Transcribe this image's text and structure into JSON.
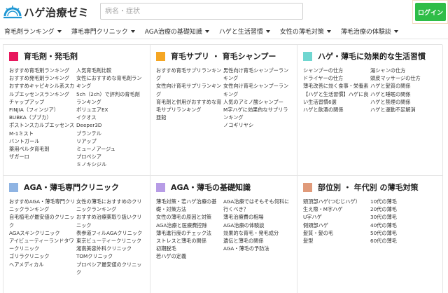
{
  "header": {
    "logo_text": "ハゲ治療ゼミ",
    "search_placeholder": "病名・症状",
    "login_label": "ログイン"
  },
  "nav": [
    "育毛剤ランキング",
    "薄毛専門クリニック",
    "AGA治療の基礎知識",
    "ハゲと生活習慣",
    "女性の薄毛対策",
    "薄毛治療の体験談"
  ],
  "colors": {
    "accent_green": "#2fbd47",
    "logo_blue": "#1f97d4"
  },
  "categories": [
    {
      "title": "育毛剤・発毛剤",
      "color": "#e8175d",
      "col1": [
        "おすすめ育毛剤ランキング",
        "おすすめ発毛剤ランキング",
        "おすすめキャピキシル系スカルプエッセンスランキング",
        "チャップアップ",
        "FINJIA（フィンジア）",
        "BUBKA（ブブカ）",
        "ポストンスカルプエッセンス",
        "M-1ミスト",
        "バントガール",
        "薬用ペルタ育毛剤",
        "ザガーロ"
      ],
      "col2": [
        "人気育毛剤比較",
        "女性におすすめな育毛剤ランキング",
        "5ch（2ch）で評判の育毛剤ランキング",
        "ボリュエアEX",
        "イクオス",
        "Deeper3D",
        "プランテル",
        "リアップ",
        "ミューノアージュ",
        "プロペシア",
        "ミノキシジル"
      ]
    },
    {
      "title": "育毛サプリ ・ 育毛シャンプー",
      "color": "#f5a623",
      "col1": [
        "おすすめ育毛サプリランキング",
        "女性向け育毛サプリランキング",
        "育毛剤と併用がおすすめな育毛サプリランキング",
        "亜鉛"
      ],
      "col2": [
        "男性向け育毛シャンプーランキング",
        "女性向け育毛シャンプーランキング",
        "人気のアミノ酸シャンプー",
        "M字ハゲに効果的なサプリランキング",
        "ノコギリヤシ"
      ]
    },
    {
      "title": "ハゲ・薄毛に効果的な生活習慣",
      "color": "#6fd6d0",
      "col1": [
        "シャンプーの仕方",
        "ドライヤーの仕方",
        "薄毛改善に効く食事・栄養素",
        "【ハゲと生活習慣】ハゲに良い生活習慣6選",
        "ハゲと飲酒の関係"
      ],
      "col2": [
        "湯シャンの仕方",
        "頭皮マッサージの仕方",
        "ハゲと髪質の関係",
        "ハゲと睡眠の関係",
        "ハゲと禁煙の関係",
        "ハゲと運動不足解消"
      ]
    },
    {
      "title": "AGA・薄毛専門クリニック",
      "color": "#8fb4e3",
      "col1": [
        "おすすめAGA・薄毛専門クリニックランキング",
        "自毛植毛が最安値のクリニック",
        "AGAスキンクリニック",
        "アイビューティーランドタワークリニック",
        "ゴリラクリニック",
        "ヘアメディカル"
      ],
      "col2": [
        "女性の薄毛におすすめのクリニックランキング",
        "おすすめ治療薬取り扱いクリニック",
        "表参道フィルAGAクリニック",
        "東京ビューティークリニック",
        "湘南美容外科クリニック",
        "TOMクリニック",
        "プロペシア最安値のクリニック"
      ]
    },
    {
      "title": "AGA・薄毛の基礎知識",
      "color": "#b79ce6",
      "col1": [
        "薄毛対策・若ハゲ治療の基礎・対策方法",
        "女性の薄毛の原因と対策",
        "AGA治療と医療費控除",
        "薄毛進行度のチェック法",
        "ストレスと薄毛の関係",
        "初期脱毛",
        "若ハゲの定義"
      ],
      "col2": [
        "AGA治療ではそもそも何科に行くべき？",
        "薄毛治療費の相場",
        "AGA治療の体験談",
        "効果的な育毛・発毛成分",
        "遺伝と薄毛の関係",
        "AGA・薄毛の予防法"
      ]
    },
    {
      "title": "部位別 ・ 年代別 の薄毛対策",
      "color": "#e09a7a",
      "col1": [
        "頭頂部ハゲ(つむじハゲ）",
        "生え際・M字ハゲ",
        "U字ハゲ",
        "側頭部ハゲ",
        "髪質・髪の毛",
        "髪型"
      ],
      "col2": [
        "10代の薄毛",
        "20代の薄毛",
        "30代の薄毛",
        "40代の薄毛",
        "50代の薄毛",
        "60代の薄毛"
      ]
    }
  ]
}
